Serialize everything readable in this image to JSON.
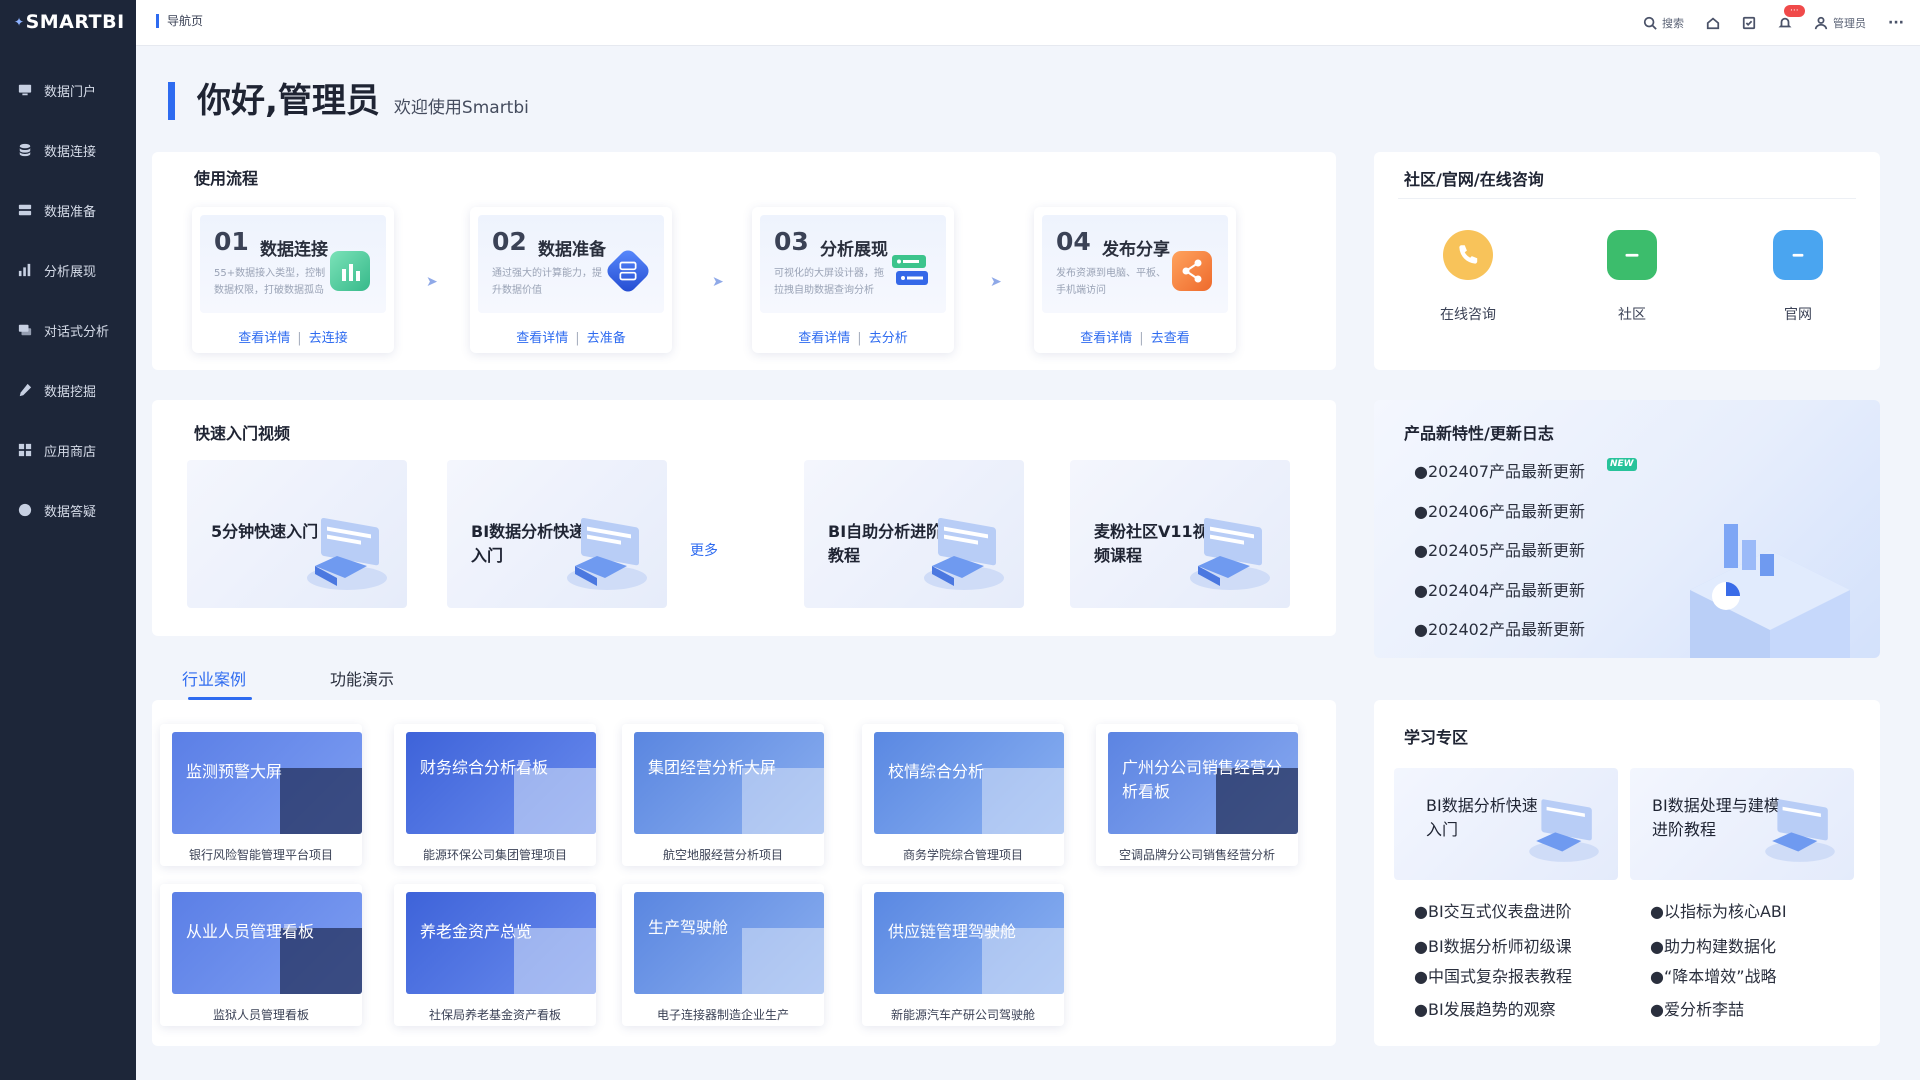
{
  "app": {
    "logo": "SMARTBI",
    "breadcrumb": "导航页"
  },
  "sidebar": {
    "items": [
      {
        "label": "数据门户",
        "icon": "portal-icon"
      },
      {
        "label": "数据连接",
        "icon": "database-icon"
      },
      {
        "label": "数据准备",
        "icon": "data-prep-icon"
      },
      {
        "label": "分析展现",
        "icon": "bar-chart-icon"
      },
      {
        "label": "对话式分析",
        "icon": "chat-icon"
      },
      {
        "label": "数据挖掘",
        "icon": "pickaxe-icon"
      },
      {
        "label": "应用商店",
        "icon": "apps-icon"
      },
      {
        "label": "数据答疑",
        "icon": "help-icon"
      }
    ]
  },
  "topbar": {
    "search": "搜索",
    "badge": "···",
    "user": "管理员",
    "more": "···"
  },
  "greeting": {
    "title": "你好,管理员",
    "subtitle": "欢迎使用Smartbi"
  },
  "workflow": {
    "title": "使用流程",
    "steps": [
      {
        "num": "01",
        "name": "数据连接",
        "desc": "55+数据接入类型，控制数据权限，打破数据孤岛",
        "link1": "查看详情",
        "link2": "去连接",
        "color": "#4cc59a"
      },
      {
        "num": "02",
        "name": "数据准备",
        "desc": "通过强大的计算能力，提升数据价值",
        "link1": "查看详情",
        "link2": "去准备",
        "color": "#3568e8"
      },
      {
        "num": "03",
        "name": "分析展现",
        "desc": "可视化的大屏设计器，拖拉拽自助数据查询分析",
        "link1": "查看详情",
        "link2": "去分析",
        "color": "#3cc48c"
      },
      {
        "num": "04",
        "name": "发布分享",
        "desc": "发布资源到电脑、平板、手机端访问",
        "link1": "查看详情",
        "link2": "去查看",
        "color": "#f07a3a"
      }
    ]
  },
  "videos": {
    "title": "快速入门视频",
    "more": "更多",
    "items": [
      {
        "title": "5分钟快速入门"
      },
      {
        "title": "BI数据分析快递入门"
      },
      {
        "title": "BI自助分析进阶教程"
      },
      {
        "title": "麦粉社区V11视频课程"
      }
    ]
  },
  "tabs": [
    {
      "label": "行业案例",
      "active": true
    },
    {
      "label": "功能演示",
      "active": false
    }
  ],
  "cases": [
    {
      "title": "监测预警大屏",
      "caption": "银行风险智能管理平台项目",
      "dark": true
    },
    {
      "title": "财务综合分析看板",
      "caption": "能源环保公司集团管理项目",
      "dark": false
    },
    {
      "title": "集团经营分析大屏",
      "caption": "航空地服经营分析项目",
      "dark": false
    },
    {
      "title": "校情综合分析",
      "caption": "商务学院综合管理项目",
      "dark": false
    },
    {
      "title": "广州分公司销售经营分析看板",
      "caption": "空调品牌分公司销售经营分析",
      "dark": true
    },
    {
      "title": "从业人员管理看板",
      "caption": "监狱人员管理看板",
      "dark": true
    },
    {
      "title": "养老金资产总览",
      "caption": "社保局养老基金资产看板",
      "dark": false
    },
    {
      "title": "生产驾驶舱",
      "caption": "电子连接器制造企业生产",
      "dark": false
    },
    {
      "title": "供应链管理驾驶舱",
      "caption": "新能源汽车产研公司驾驶舱",
      "dark": false
    }
  ],
  "community": {
    "title": "社区/官网/在线咨询",
    "items": [
      {
        "label": "在线咨询",
        "icon": "phone-icon",
        "color": "#f6b93b"
      },
      {
        "label": "社区",
        "icon": "chat-bubble-icon",
        "color": "#3cbd6c"
      },
      {
        "label": "官网",
        "icon": "monitor-icon",
        "color": "#4aa5f0"
      }
    ]
  },
  "news": {
    "title": "产品新特性/更新日志",
    "new_badge": "NEW",
    "items": [
      "●202407产品最新更新",
      "●202406产品最新更新",
      "●202405产品最新更新",
      "●202404产品最新更新",
      "●202402产品最新更新"
    ]
  },
  "learning": {
    "title": "学习专区",
    "cards": [
      {
        "title": "BI数据分析快速入门"
      },
      {
        "title": "BI数据处理与建模进阶教程"
      }
    ],
    "left": [
      "●BI交互式仪表盘进阶",
      "●BI数据分析师初级课",
      "●中国式复杂报表教程",
      "●BI发展趋势的观察"
    ],
    "right": [
      "●以指标为核心ABI",
      "●助力构建数据化",
      "●“降本增效”战略",
      "●爱分析李喆"
    ]
  }
}
